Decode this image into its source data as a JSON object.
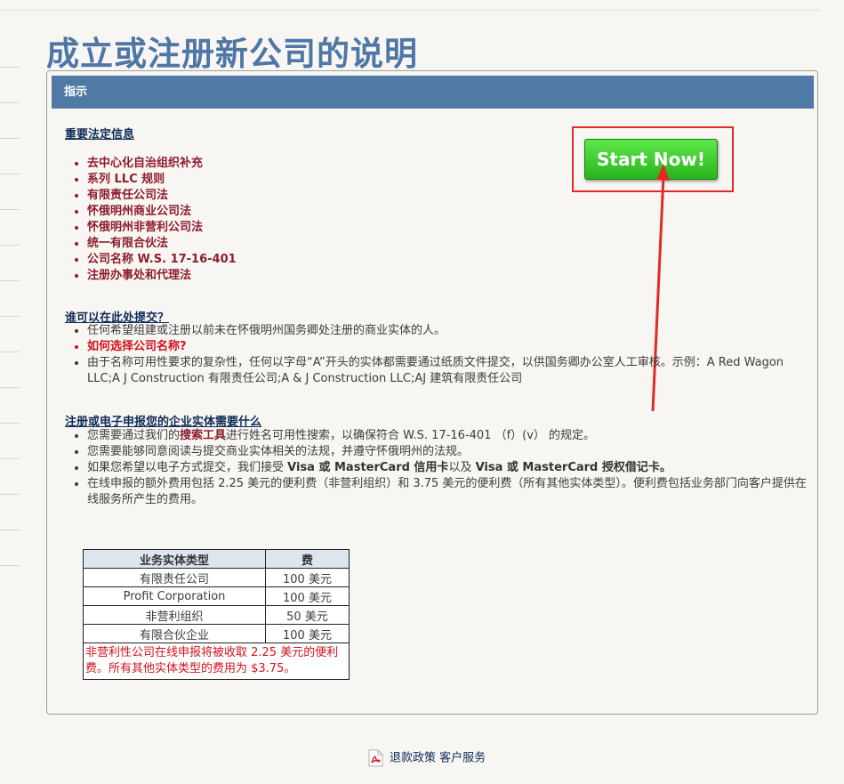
{
  "page": {
    "title": "成立或注册新公司的说明",
    "panel_header": "指示"
  },
  "start_button": {
    "label": "Start Now!"
  },
  "legal": {
    "title": "重要法定信息",
    "items": [
      "去中心化自治组织补充",
      "系列 LLC 规则",
      "有限责任公司法",
      "怀俄明州商业公司法",
      "怀俄明州非营利公司法",
      "统一有限合伙法",
      "公司名称 W.S. 17-16-401",
      "注册办事处和代理法"
    ]
  },
  "who": {
    "title": "谁可以在此处提交？",
    "items": [
      "任何希望组建或注册以前未在怀俄明州国务卿处注册的商业实体的人。",
      "如何选择公司名称?",
      "由于名称可用性要求的复杂性，任何以字母“A”开头的实体都需要通过纸质文件提交，以供国务卿办公室人工审核。示例：A Red Wagon LLC;A J Construction 有限责任公司;A & J Construction LLC;AJ 建筑有限责任公司"
    ]
  },
  "needs": {
    "title": "注册或电子申报您的企业实体需要什么",
    "item1_pre": "您需要通过我们的",
    "item1_link": "搜索工具",
    "item1_post": "进行姓名可用性搜索，以确保符合 W.S. 17-16-401 （f）(v） 的规定。",
    "item2": "您需要能够同意阅读与提交商业实体相关的法规，并遵守怀俄明州的法规。",
    "item3_pre": "如果您希望以电子方式提交，我们接受 ",
    "item3_b1": "Visa 或 MasterCard 信用卡",
    "item3_mid": "以及 ",
    "item3_b2": "Visa 或 MasterCard 授权借记卡。",
    "item4": "在线申报的额外费用包括 2.25 美元的便利费（非营利组织）和 3.75 美元的便利费（所有其他实体类型）。便利费包括业务部门向客户提供在线服务所产生的费用。"
  },
  "fees": {
    "headers": [
      "业务实体类型",
      "费"
    ],
    "rows": [
      [
        "有限责任公司",
        "100 美元"
      ],
      [
        "Profit Corporation",
        "100 美元"
      ],
      [
        "非营利组织",
        "50 美元"
      ],
      [
        "有限合伙企业",
        "100 美元"
      ]
    ],
    "note": "非营利性公司在线申报将被收取 2.25 美元的便利费。所有其他实体类型的费用为 $3.75。"
  },
  "footer": {
    "links": [
      "退款政策",
      "客户服务"
    ],
    "icon": "pdf-icon"
  },
  "colors": {
    "title": "#4f77a6",
    "header_bar": "#5079a6",
    "legal_items": "#8e1c2d",
    "alert_red": "#d0121b",
    "start_green": "#27b51c",
    "annotation_red": "#e02b25"
  }
}
